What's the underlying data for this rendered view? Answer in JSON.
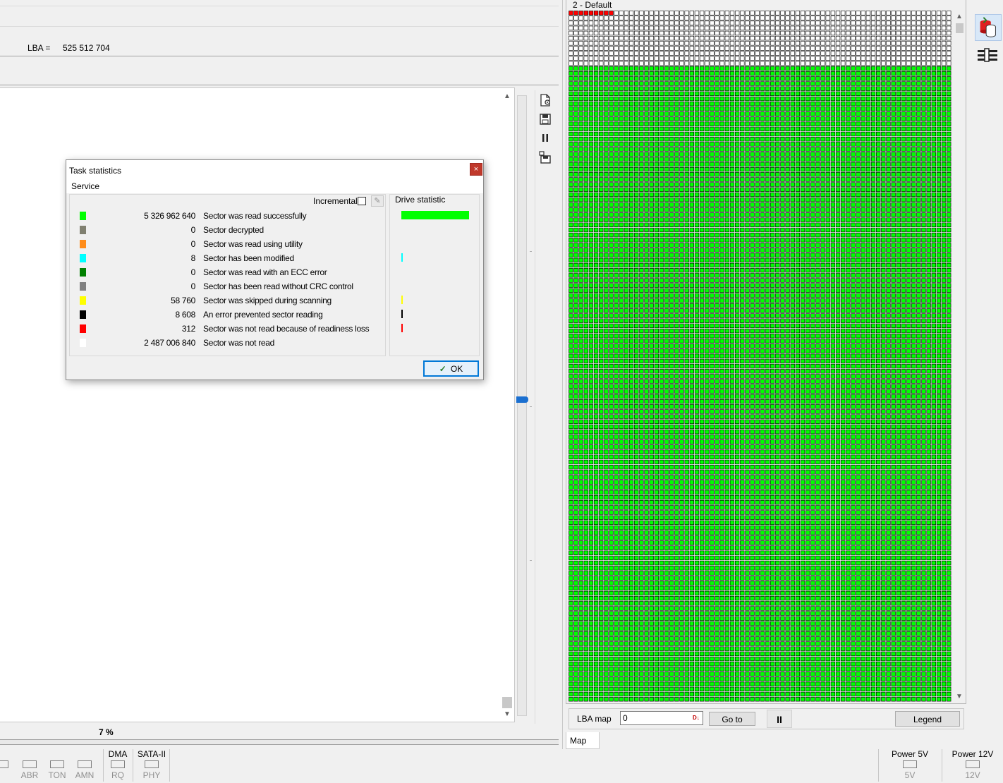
{
  "header": {
    "lba_label": "LBA =",
    "lba_value": "525 512 704"
  },
  "progress": {
    "percent_text": "7 %",
    "marker_fraction": 0.49
  },
  "status_bar": {
    "groups": [
      {
        "title": "",
        "leds": [
          "",
          "ABR",
          "TON",
          "AMN"
        ]
      },
      {
        "title": "DMA",
        "leds": [
          "RQ"
        ]
      },
      {
        "title": "SATA-II",
        "leds": [
          "PHY"
        ]
      },
      {
        "title": "Power 5V",
        "leds": [
          "5V"
        ]
      },
      {
        "title": "Power 12V",
        "leds": [
          "12V"
        ]
      }
    ]
  },
  "map": {
    "title": "2 - Default",
    "lba_map_label": "LBA map",
    "lba_map_value": "0",
    "goto_label": "Go to",
    "pause_label": "II",
    "legend_label": "Legend",
    "tab_label": "Map",
    "colors": {
      "read": "#00ff00",
      "unread": "#ffffff",
      "error": "#ff0000",
      "border": "#000000"
    }
  },
  "dialog": {
    "title": "Task statistics",
    "close_label": "×",
    "menu_service": "Service",
    "incremental_label": "Incremental",
    "drive_statistic_label": "Drive statistic",
    "ok_label": "OK",
    "rows": [
      {
        "color": "#00ff00",
        "value": "5 326 962 640",
        "desc": "Sector was read successfully",
        "bar_fraction": 0.68
      },
      {
        "color": "#808070",
        "value": "0",
        "desc": "Sector decrypted",
        "bar_fraction": 0
      },
      {
        "color": "#ff8c1a",
        "value": "0",
        "desc": "Sector was read using utility",
        "bar_fraction": 0
      },
      {
        "color": "#00ffff",
        "value": "8",
        "desc": "Sector has been modified",
        "bar_fraction": 0.001
      },
      {
        "color": "#008000",
        "value": "0",
        "desc": "Sector was read with an ECC error",
        "bar_fraction": 0
      },
      {
        "color": "#808080",
        "value": "0",
        "desc": "Sector has been read without CRC control",
        "bar_fraction": 0
      },
      {
        "color": "#ffff00",
        "value": "58 760",
        "desc": "Sector was skipped during scanning",
        "bar_fraction": 0.001
      },
      {
        "color": "#000000",
        "value": "8 608",
        "desc": "An error prevented sector reading",
        "bar_fraction": 0.001
      },
      {
        "color": "#ff0000",
        "value": "312",
        "desc": "Sector was not read because of readiness loss",
        "bar_fraction": 0.001
      },
      {
        "color": "#ffffff",
        "value": "2 487 006 840",
        "desc": "Sector was not read",
        "bar_fraction": 0
      }
    ]
  }
}
